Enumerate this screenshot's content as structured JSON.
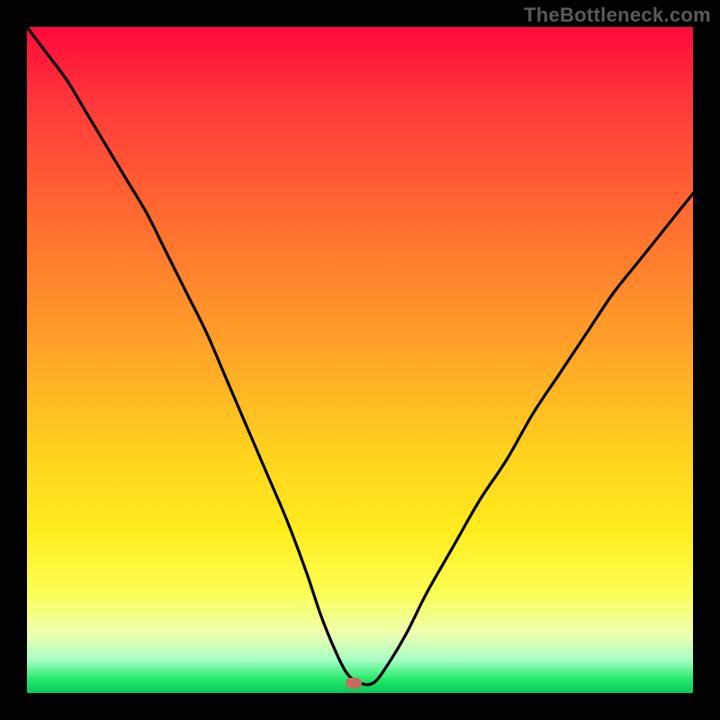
{
  "watermark": "TheBottleneck.com",
  "colors": {
    "background": "#000000",
    "gradient_top": "#ff0a3a",
    "gradient_bottom": "#08c858",
    "curve": "#000000",
    "marker": "#c76a62",
    "watermark": "#5a5a5a"
  },
  "chart_data": {
    "type": "line",
    "title": "",
    "xlabel": "",
    "ylabel": "",
    "xlim": [
      0,
      100
    ],
    "ylim": [
      0,
      100
    ],
    "grid": false,
    "legend": false,
    "annotations": [
      {
        "type": "marker",
        "x": 49,
        "y": 1.5,
        "shape": "rounded-rect",
        "color": "#c76a62"
      }
    ],
    "series": [
      {
        "name": "bottleneck-curve",
        "x": [
          0,
          3,
          6,
          9,
          12,
          15,
          18,
          21,
          24,
          27,
          30,
          33,
          36,
          39,
          42,
          44,
          46,
          48,
          50,
          52,
          54,
          57,
          60,
          64,
          68,
          72,
          76,
          80,
          84,
          88,
          92,
          96,
          100
        ],
        "values": [
          100,
          96,
          92,
          87,
          82,
          77,
          72,
          66,
          60,
          54,
          47,
          40,
          33,
          26,
          18,
          12,
          7,
          3,
          1.5,
          1.5,
          4,
          9,
          15,
          22,
          29,
          35,
          42,
          48,
          54,
          60,
          65,
          70,
          75
        ]
      }
    ]
  }
}
